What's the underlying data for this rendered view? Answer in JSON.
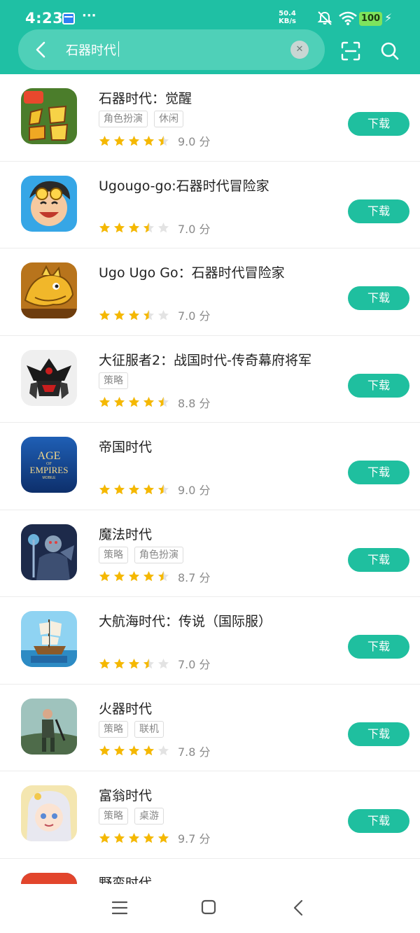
{
  "status_bar": {
    "time": "4:23",
    "more": "···",
    "net_speed_value": "50.4",
    "net_speed_unit": "KB/s",
    "battery": "100"
  },
  "search": {
    "query": "石器时代",
    "back_icon": "chevron-left-icon",
    "clear_icon": "clear-icon",
    "scan_icon": "scan-icon",
    "search_icon": "search-icon"
  },
  "results": [
    {
      "title": "石器时代：觉醒",
      "tags": [
        "角色扮演",
        "休闲"
      ],
      "stars": 4.5,
      "score": "9.0 分",
      "button": "下载"
    },
    {
      "title": "Ugougo-go:石器时代冒险家",
      "tags": [],
      "stars": 3.5,
      "score": "7.0 分",
      "button": "下载"
    },
    {
      "title": "Ugo Ugo Go：石器时代冒险家",
      "tags": [],
      "stars": 3.5,
      "score": "7.0 分",
      "button": "下载"
    },
    {
      "title": "大征服者2：战国时代-传奇幕府将军",
      "tags": [
        "策略"
      ],
      "stars": 4.5,
      "score": "8.8 分",
      "button": "下载"
    },
    {
      "title": "帝国时代",
      "tags": [],
      "stars": 4.5,
      "score": "9.0 分",
      "button": "下载",
      "icon_text": [
        "AGE",
        "OF",
        "EMPIRES",
        "MOBILE"
      ]
    },
    {
      "title": "魔法时代",
      "tags": [
        "策略",
        "角色扮演"
      ],
      "stars": 4.5,
      "score": "8.7 分",
      "button": "下载"
    },
    {
      "title": "大航海时代：传说（国际服）",
      "tags": [],
      "stars": 3.5,
      "score": "7.0 分",
      "button": "下载"
    },
    {
      "title": "火器时代",
      "tags": [
        "策略",
        "联机"
      ],
      "stars": 4,
      "score": "7.8 分",
      "button": "下载"
    },
    {
      "title": "富翁时代",
      "tags": [
        "策略",
        "桌游"
      ],
      "stars": 5,
      "score": "9.7 分",
      "button": "下载"
    },
    {
      "title": "野蛮时代",
      "tags": [],
      "stars": null,
      "score": "",
      "button": ""
    }
  ],
  "colors": {
    "accent": "#1fc0a4",
    "button": "#1fbf9f",
    "star": "#f5b800",
    "star_empty": "#e3e3e3"
  },
  "nav": {
    "menu_icon": "menu-icon",
    "home_icon": "home-square-icon",
    "back_icon": "back-chevron-icon"
  }
}
